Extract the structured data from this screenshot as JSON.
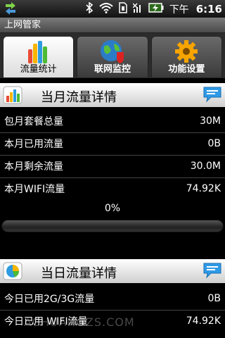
{
  "status_bar": {
    "ampm": "下午",
    "time": "6:16"
  },
  "app": {
    "title": "上网管家"
  },
  "tabs": [
    {
      "label": "流量统计",
      "active": true,
      "icon": "bar-chart-icon"
    },
    {
      "label": "联网监控",
      "active": false,
      "icon": "globe-shield-icon"
    },
    {
      "label": "功能设置",
      "active": false,
      "icon": "gear-icon"
    }
  ],
  "monthly": {
    "header": "当月流量详情",
    "rows": [
      {
        "label": "包月套餐总量",
        "value": "30M"
      },
      {
        "label": "本月已用流量",
        "value": "0B"
      },
      {
        "label": "本月剩余流量",
        "value": "30.0M"
      },
      {
        "label": "本月WIFI流量",
        "value": "74.92K"
      }
    ],
    "usage_percent_text": "0%",
    "usage_fraction": 0
  },
  "daily": {
    "header": "当日流量详情",
    "rows": [
      {
        "label": "今日已用2G/3G流量",
        "value": "0B"
      },
      {
        "label": "今日已用 WIFI流量",
        "value": "74.92K"
      }
    ]
  },
  "watermark": "ACHUANGZS.COM",
  "colors": {
    "progress_fill": "#5fae2a",
    "header_bg": "#ffffff",
    "bar_chart_colors": [
      "#e94b35",
      "#f7b500",
      "#2e9be0",
      "#4dbb35"
    ]
  }
}
